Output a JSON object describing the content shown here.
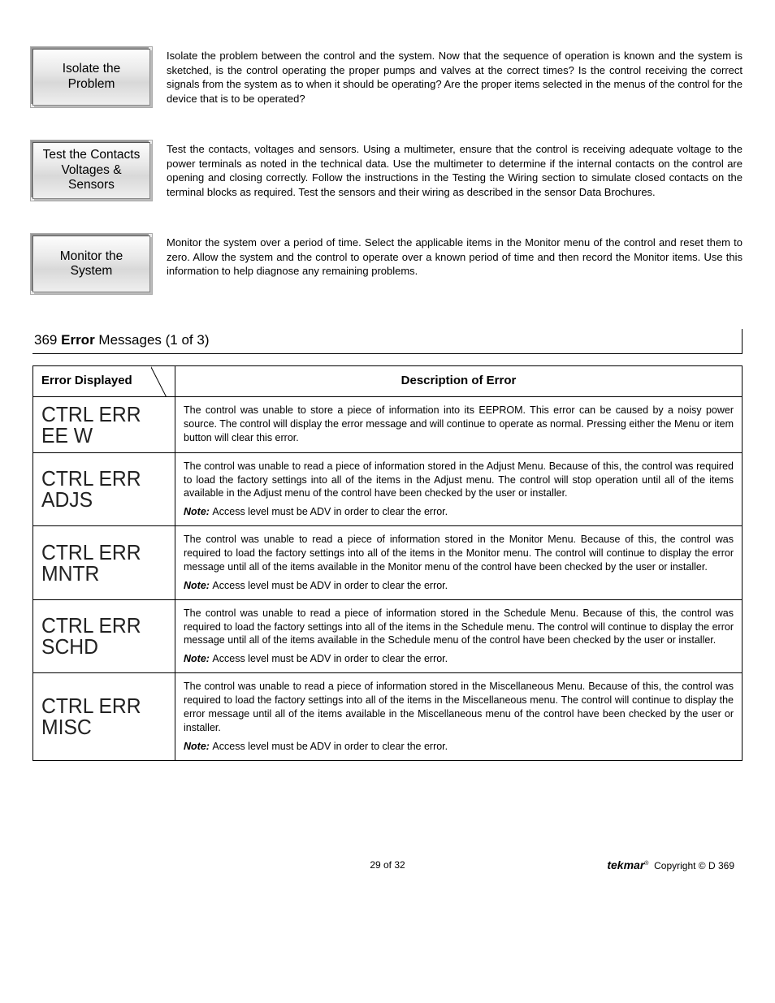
{
  "info_blocks": [
    {
      "label": "Isolate the\nProblem",
      "text": "Isolate the problem between the control and the system. Now that the sequence of operation is known and the system is sketched, is the control operating the proper pumps and valves at the correct times? Is the control receiving the correct signals from the system as to when it should be operating? Are the proper items selected in the menus of the control for the device that is to be operated?"
    },
    {
      "label": "Test the Contacts\nVoltages &\nSensors",
      "text": "Test the contacts, voltages and sensors. Using a multimeter, ensure that the control is receiving adequate voltage to the power terminals as noted in the technical data. Use the multimeter to determine if the internal contacts on the control are opening and closing correctly. Follow the instructions in the Testing the Wiring section to simulate closed contacts on the terminal blocks as required. Test the sensors and their wiring as described in the sensor Data Brochures."
    },
    {
      "label": "Monitor the\nSystem",
      "text": "Monitor the system over a period of time. Select the applicable items in the Monitor menu of the control and reset them to zero. Allow the system and the control to operate over a known period of time and then record the Monitor items. Use this information to help diagnose any remaining problems."
    }
  ],
  "section": {
    "num": "369",
    "bold": "Error",
    "rest": "Messages (1 of 3)"
  },
  "table": {
    "headers": [
      "Error Displayed",
      "Description of Error"
    ],
    "rows": [
      {
        "code_l1": "CTRL ERR",
        "code_l2": "EE W",
        "desc": "The control was unable to store a piece of information into its EEPROM. This error can be caused by a noisy power source. The control will display the error message and will continue to operate as normal. Pressing either the Menu or item button will clear this error.",
        "note": ""
      },
      {
        "code_l1": "CTRL ERR",
        "code_l2": "ADJS",
        "desc": "The control was unable to read a piece of information stored in the Adjust Menu. Because of this, the control was required to load the factory settings into all of the items in the Adjust menu. The control will stop operation until all of the items available in the Adjust menu of the control have been checked by the user or installer.",
        "note": "Access level must be ADV in order to clear the error."
      },
      {
        "code_l1": "CTRL ERR",
        "code_l2": "MNTR",
        "desc": "The control was unable to read a piece of information stored in the Monitor Menu. Because of this, the control was required to load the factory settings into all of the items in the Monitor menu. The control will continue to display the error message until all of the items available in the Monitor menu of the control have been checked by the user or installer.",
        "note": "Access level must be ADV in order to clear the error."
      },
      {
        "code_l1": "CTRL ERR",
        "code_l2": "SCHD",
        "desc": "The control was unable to read a piece of information stored in the Schedule Menu. Because of this, the control was required to load the factory settings into all of the items in the Schedule menu. The control will continue to display the error message until all of the items available in the Schedule menu of the control have been checked by the user or installer.",
        "note": "Access level must be ADV in order to clear the error."
      },
      {
        "code_l1": "CTRL ERR",
        "code_l2": "MISC",
        "desc": "The control was unable to read a piece of information stored in the Miscellaneous Menu. Because of this, the control was required to load the factory settings into all of the items in the Miscellaneous menu. The control will continue to display the error message until all of the items available in the Miscellaneous menu of the control have been checked by the user or installer.",
        "note": "Access level must be ADV in order to clear the error."
      }
    ]
  },
  "footer": {
    "page": "29 of 32",
    "brand": "tekmar",
    "copyright": "Copyright © D 369"
  },
  "note_label": "Note:"
}
